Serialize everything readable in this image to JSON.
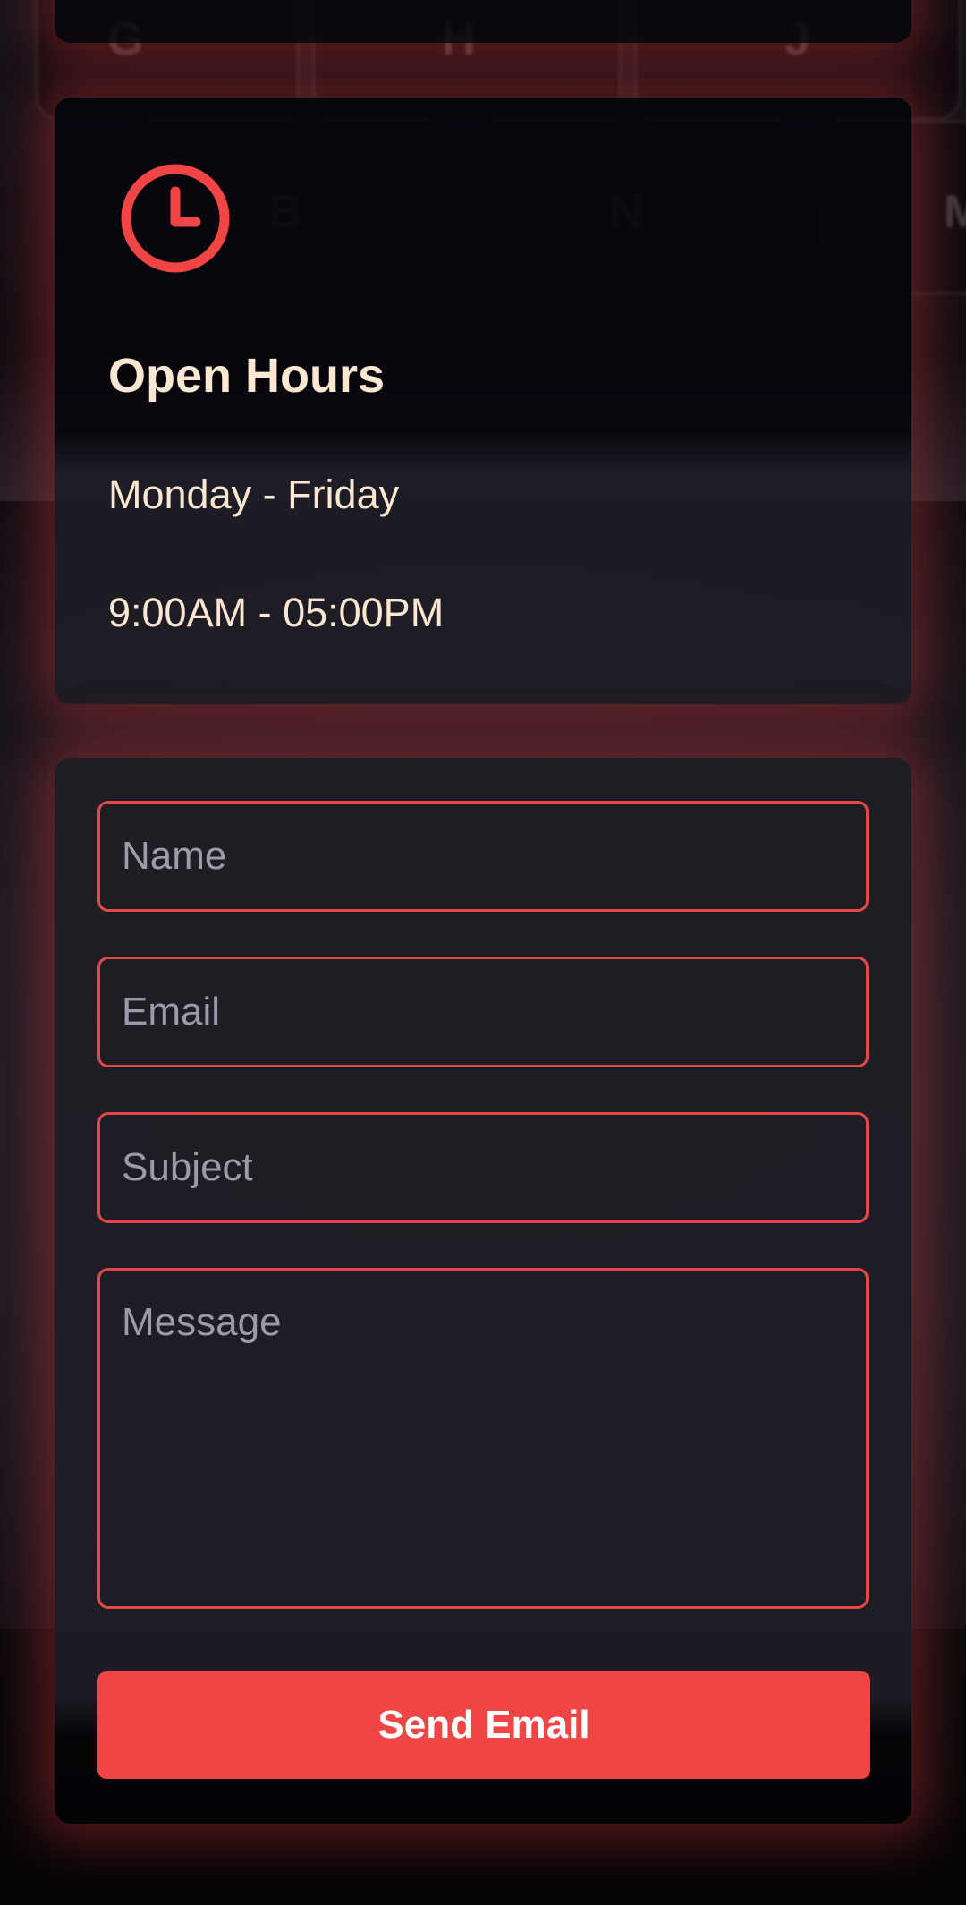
{
  "accent_color": "#ef4545",
  "background_keys": [
    "G",
    "H",
    "J",
    "B",
    "N",
    "M"
  ],
  "hours_card": {
    "icon": "clock-icon",
    "title": "Open Hours",
    "days": "Monday - Friday",
    "time": "9:00AM - 05:00PM"
  },
  "contact_form": {
    "name_placeholder": "Name",
    "email_placeholder": "Email",
    "subject_placeholder": "Subject",
    "message_placeholder": "Message",
    "submit_label": "Send Email"
  }
}
